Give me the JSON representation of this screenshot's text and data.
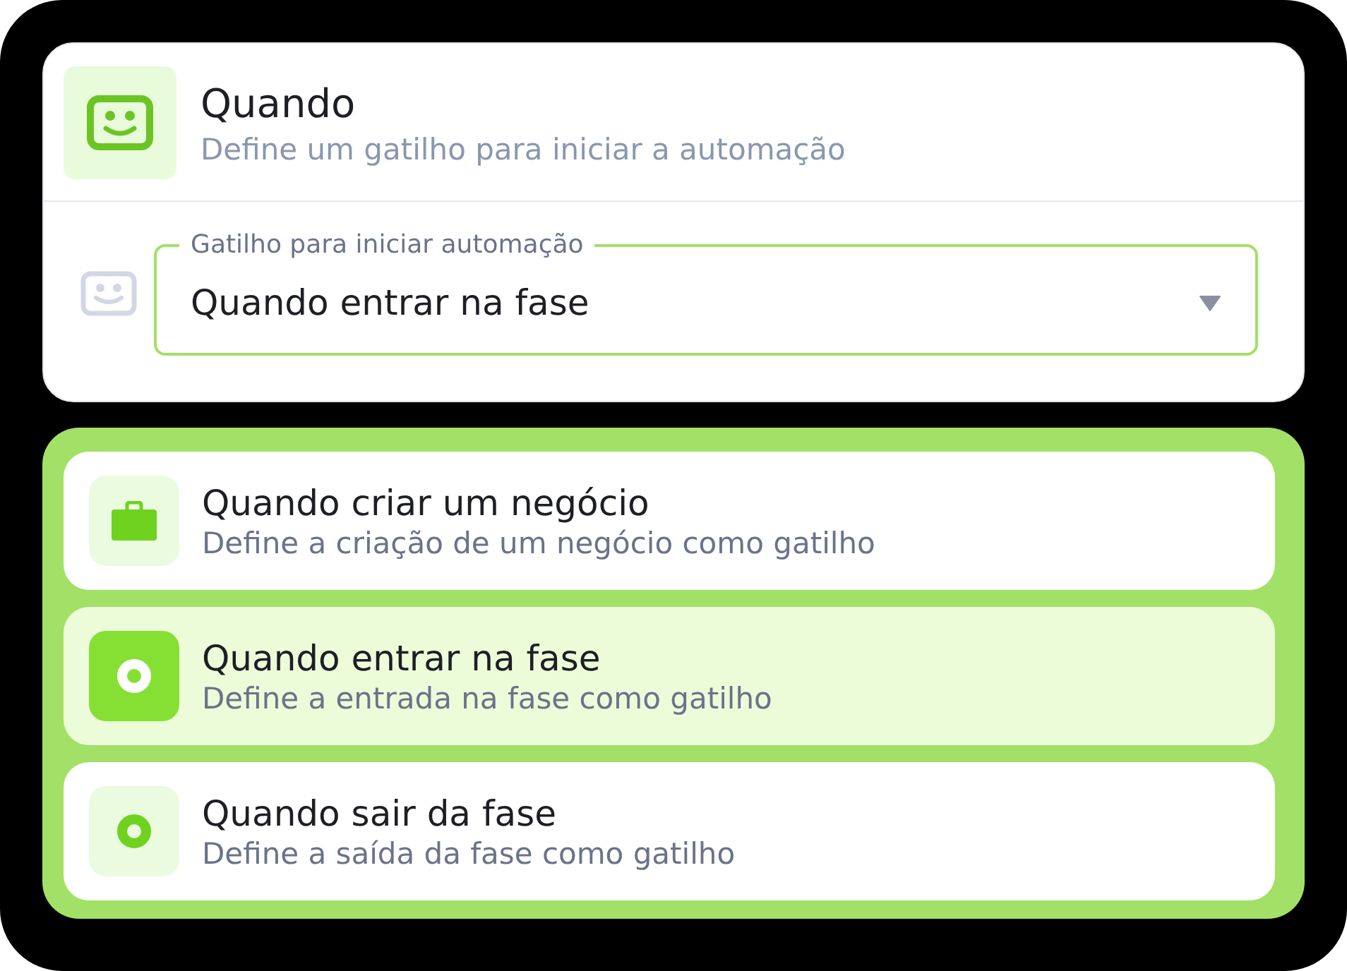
{
  "header": {
    "title": "Quando",
    "subtitle": "Define um gatilho para iniciar a automação"
  },
  "trigger_field": {
    "label": "Gatilho para iniciar automação",
    "value": "Quando entrar na fase"
  },
  "options": [
    {
      "kind": "briefcase",
      "title": "Quando criar um negócio",
      "description": "Define a criação de um negócio como gatilho",
      "selected": false
    },
    {
      "kind": "ring",
      "title": "Quando entrar na fase",
      "description": "Define a entrada na fase como gatilho",
      "selected": true
    },
    {
      "kind": "ring",
      "title": "Quando sair da fase",
      "description": "Define a saída da fase como gatilho",
      "selected": false
    }
  ]
}
